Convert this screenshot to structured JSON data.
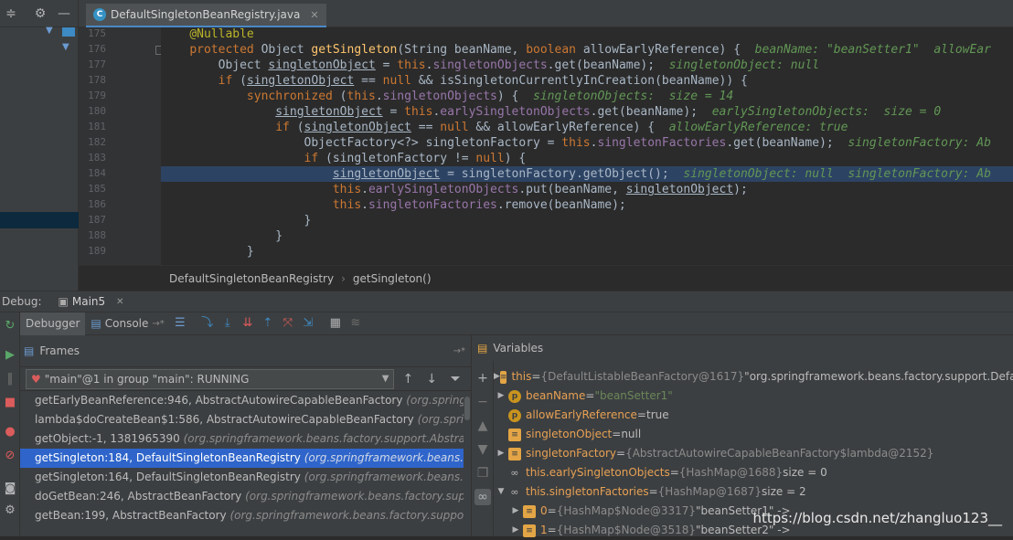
{
  "editor": {
    "tab_label": "DefaultSingletonBeanRegistry.java",
    "gutter_lines": [
      "175",
      "176",
      "177",
      "178",
      "179",
      "180",
      "181",
      "182",
      "183",
      "184",
      "185",
      "186",
      "187",
      "188",
      "189"
    ],
    "breadcrumb": [
      "DefaultSingletonBeanRegistry",
      "getSingleton()"
    ],
    "hints": {
      "l176": "beanName: \"beanSetter1\"  allowEar",
      "l177": "singletonObject: null",
      "l179": "singletonObjects:  size = 14",
      "l180": "earlySingletonObjects:  size = 0",
      "l181": "allowEarlyReference: true",
      "l182": "singletonFactory: Ab",
      "l184": "singletonObject: null  singletonFactory: Ab"
    }
  },
  "debug": {
    "label": "Debug:",
    "run_tab": "Main5",
    "tabs": [
      "Debugger",
      "Console"
    ]
  },
  "frames": {
    "title": "Frames",
    "thread": "\"main\"@1 in group \"main\": RUNNING",
    "items": [
      {
        "m": "getEarlyBeanReference:946, AbstractAutowireCapableBeanFactory",
        "p": "(org.springframe"
      },
      {
        "m": "lambda$doCreateBean$1:586, AbstractAutowireCapableBeanFactory",
        "p": "(org.springfra"
      },
      {
        "m": "getObject:-1, 1381965390",
        "p": "(org.springframework.beans.factory.support.AbstractAut"
      },
      {
        "m": "getSingleton:184, DefaultSingletonBeanRegistry",
        "p": "(org.springframework.beans.facto"
      },
      {
        "m": "getSingleton:164, DefaultSingletonBeanRegistry",
        "p": "(org.springframework.beans.facto"
      },
      {
        "m": "doGetBean:246, AbstractBeanFactory",
        "p": "(org.springframework.beans.factory.suppor"
      },
      {
        "m": "getBean:199, AbstractBeanFactory",
        "p": "(org.springframework.beans.factory.support)"
      }
    ]
  },
  "variables": {
    "title": "Variables",
    "items": [
      {
        "name": "this",
        "eq": " = ",
        "gray": "{DefaultListableBeanFactory@1617}",
        "val": " \"org.springframework.beans.factory.support.Defa"
      },
      {
        "name": "beanName",
        "eq": " = ",
        "gray": "",
        "val": "\"beanSetter1\""
      },
      {
        "name": "allowEarlyReference",
        "eq": " = ",
        "gray": "",
        "val": "true"
      },
      {
        "name": "singletonObject",
        "eq": " = ",
        "gray": "",
        "val": "null"
      },
      {
        "name": "singletonFactory",
        "eq": " = ",
        "gray": "{AbstractAutowireCapableBeanFactory$lambda@2152}",
        "val": ""
      },
      {
        "name": "this.earlySingletonObjects",
        "eq": " = ",
        "gray": "{HashMap@1688}",
        "val": "  size = 0"
      },
      {
        "name": "this.singletonFactories",
        "eq": " = ",
        "gray": "{HashMap@1687}",
        "val": "  size = 2"
      },
      {
        "name": "0",
        "eq": " = ",
        "gray": "{HashMap$Node@3317}",
        "val": " \"beanSetter1\" ->"
      },
      {
        "name": "1",
        "eq": " = ",
        "gray": "{HashMap$Node@3518}",
        "val": " \"beanSetter2\" ->"
      }
    ]
  },
  "watermark": "https://blog.csdn.net/zhangluo123__"
}
